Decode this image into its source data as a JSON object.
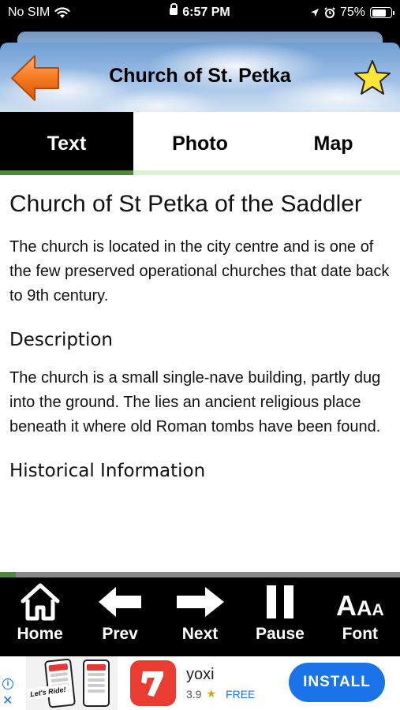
{
  "status_bar": {
    "carrier": "No SIM",
    "time": "6:57 PM",
    "battery_percent": "75%",
    "battery_level": 0.75
  },
  "header": {
    "title": "Church of St. Petka",
    "back_icon": "back-arrow-icon",
    "favorite_icon": "star-icon",
    "colors": {
      "arrow": "#f47a20",
      "star": "#ffe53a"
    }
  },
  "tabs": [
    {
      "label": "Text",
      "active": true
    },
    {
      "label": "Photo",
      "active": false
    },
    {
      "label": "Map",
      "active": false
    }
  ],
  "article": {
    "title": "Church of St Petka of the Saddler",
    "intro": "The church is located in the city centre and is one of the few preserved operational churches that date back to 9th century.",
    "sections": [
      {
        "heading": "Description",
        "body": "The church is a small single-nave building, partly dug into the ground. The lies an ancient religious place beneath it where old Roman tombs have been found."
      },
      {
        "heading": "Historical Information",
        "body": ""
      }
    ],
    "progress": 0.04
  },
  "toolbar": {
    "items": [
      {
        "label": "Home",
        "icon": "home-icon"
      },
      {
        "label": "Prev",
        "icon": "left-arrow-icon"
      },
      {
        "label": "Next",
        "icon": "right-arrow-icon"
      },
      {
        "label": "Pause",
        "icon": "pause-icon"
      },
      {
        "label": "Font",
        "icon": "font-size-icon",
        "glyph": "AAA"
      }
    ]
  },
  "ad": {
    "image_caption": "Let's Ride!",
    "app_name": "yoxi",
    "rating": "3.9",
    "price": "FREE",
    "install_label": "INSTALL",
    "info_icon": "info-icon",
    "close_icon": "close-icon",
    "colors": {
      "button": "#1a73e8",
      "app_icon": "#ea3c30"
    }
  }
}
